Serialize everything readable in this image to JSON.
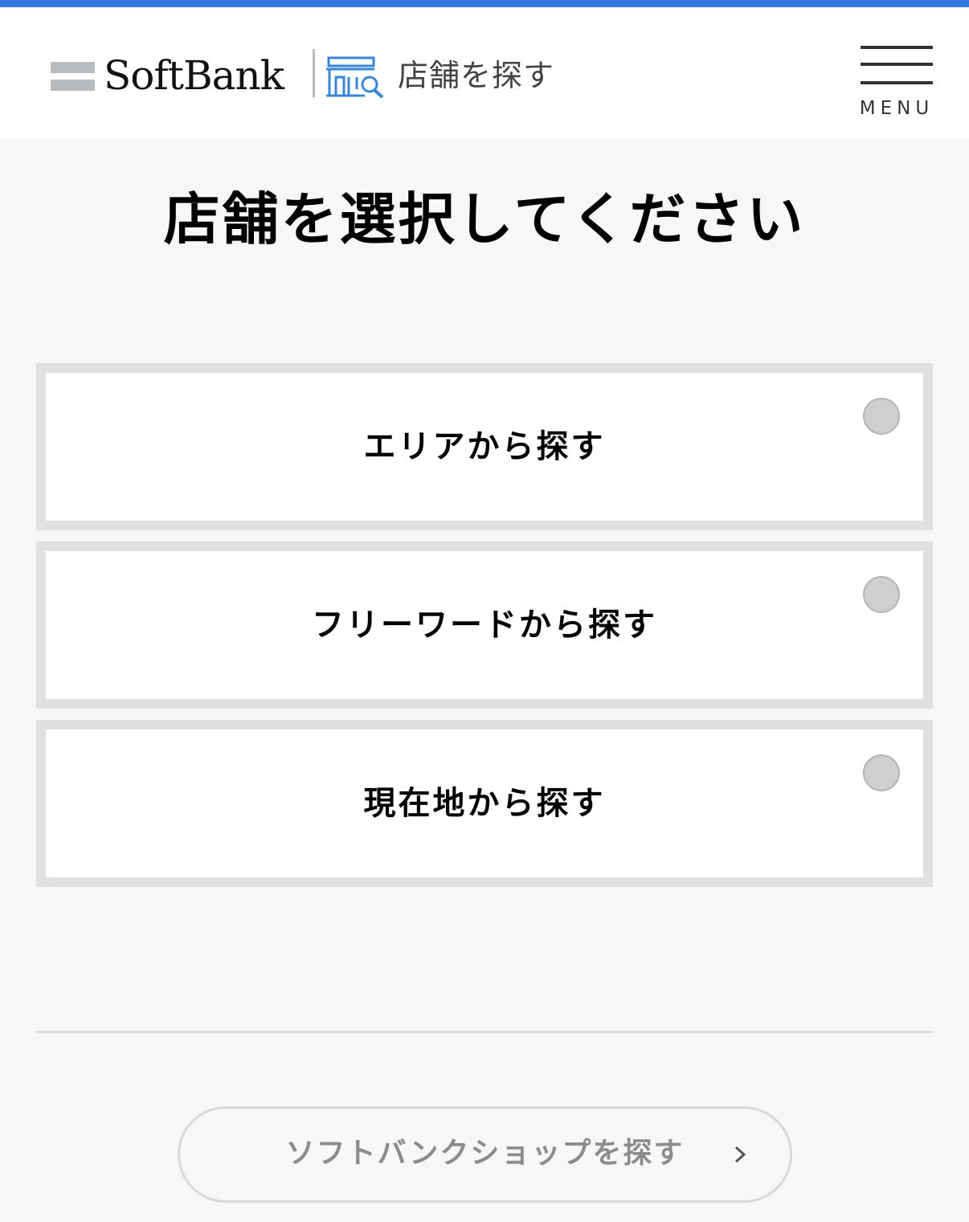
{
  "colors": {
    "accent_bar": "#3478e4",
    "store_icon": "#3a86d6",
    "card_border": "#e0e0e0",
    "radio_fill": "#cfcfcf"
  },
  "header": {
    "logo_text": "SoftBank",
    "logo_icon": "softbank-bars-mark",
    "section_icon": "store-search-icon",
    "section_title": "店舗を探す",
    "menu_icon": "hamburger-icon",
    "menu_label": "MENU"
  },
  "main": {
    "title": "店舗を選択してください",
    "options": [
      {
        "label": "エリアから探す",
        "selected": false
      },
      {
        "label": "フリーワードから探す",
        "selected": false
      },
      {
        "label": "現在地から探す",
        "selected": false
      }
    ]
  },
  "footer": {
    "shop_button_label": "ソフトバンクショップを探す",
    "shop_button_icon": "chevron-right-icon"
  }
}
